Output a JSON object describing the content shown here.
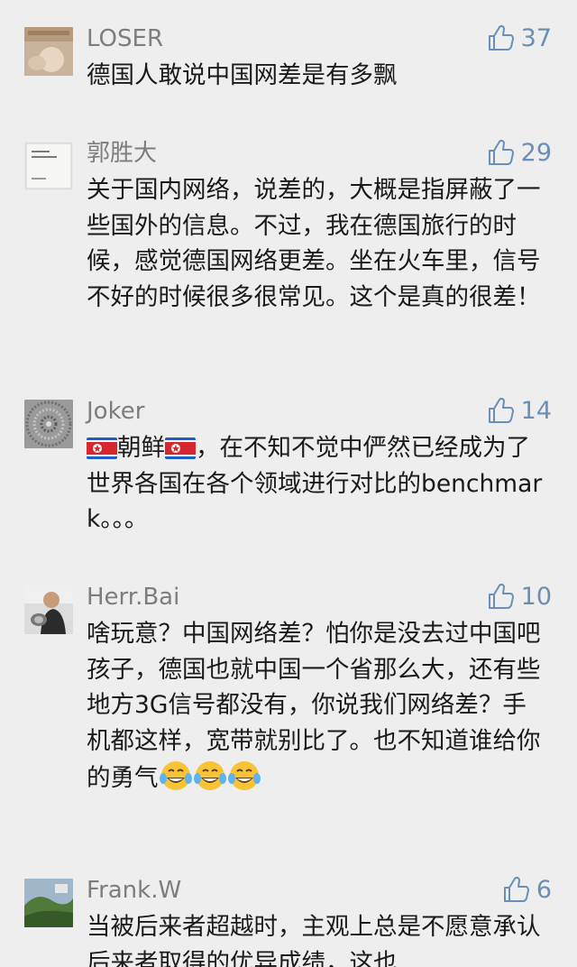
{
  "comments": [
    {
      "username": "LOSER",
      "likes": "37",
      "text": "德国人敢说中国网差是有多飘"
    },
    {
      "username": "郭胜大",
      "likes": "29",
      "text": "关于国内网络，说差的，大概是指屏蔽了一些国外的信息。不过，我在德国旅行的时候，感觉德国网络更差。坐在火车里，信号不好的时候很多很常见。这个是真的很差！"
    },
    {
      "username": "Joker",
      "likes": "14",
      "text_part1": "朝鲜",
      "text_part2": "，在不知不觉中俨然已经成为了世界各国在各个领域进行对比的benchmark。。。"
    },
    {
      "username": "Herr.Bai",
      "likes": "10",
      "text": "啥玩意？中国网络差？怕你是没去过中国吧孩子，德国也就中国一个省那么大，还有些地方3G信号都没有，你说我们网络差？手机都这样，宽带就别比了。也不知道谁给你的勇气"
    },
    {
      "username": "Frank.W",
      "likes": "6",
      "text": "当被后来者超越时，主观上总是不愿意承认后来者取得的优异成绩，这也"
    }
  ],
  "colors": {
    "background": "#eeeeee",
    "username": "#7d7d7d",
    "like_accent": "#6a8fb6",
    "body_text": "#1a1a1a"
  },
  "icons": {
    "like": "thumbs-up-icon",
    "flag": "north-korea-flag-icon",
    "laugh": "tears-of-joy-icon"
  }
}
